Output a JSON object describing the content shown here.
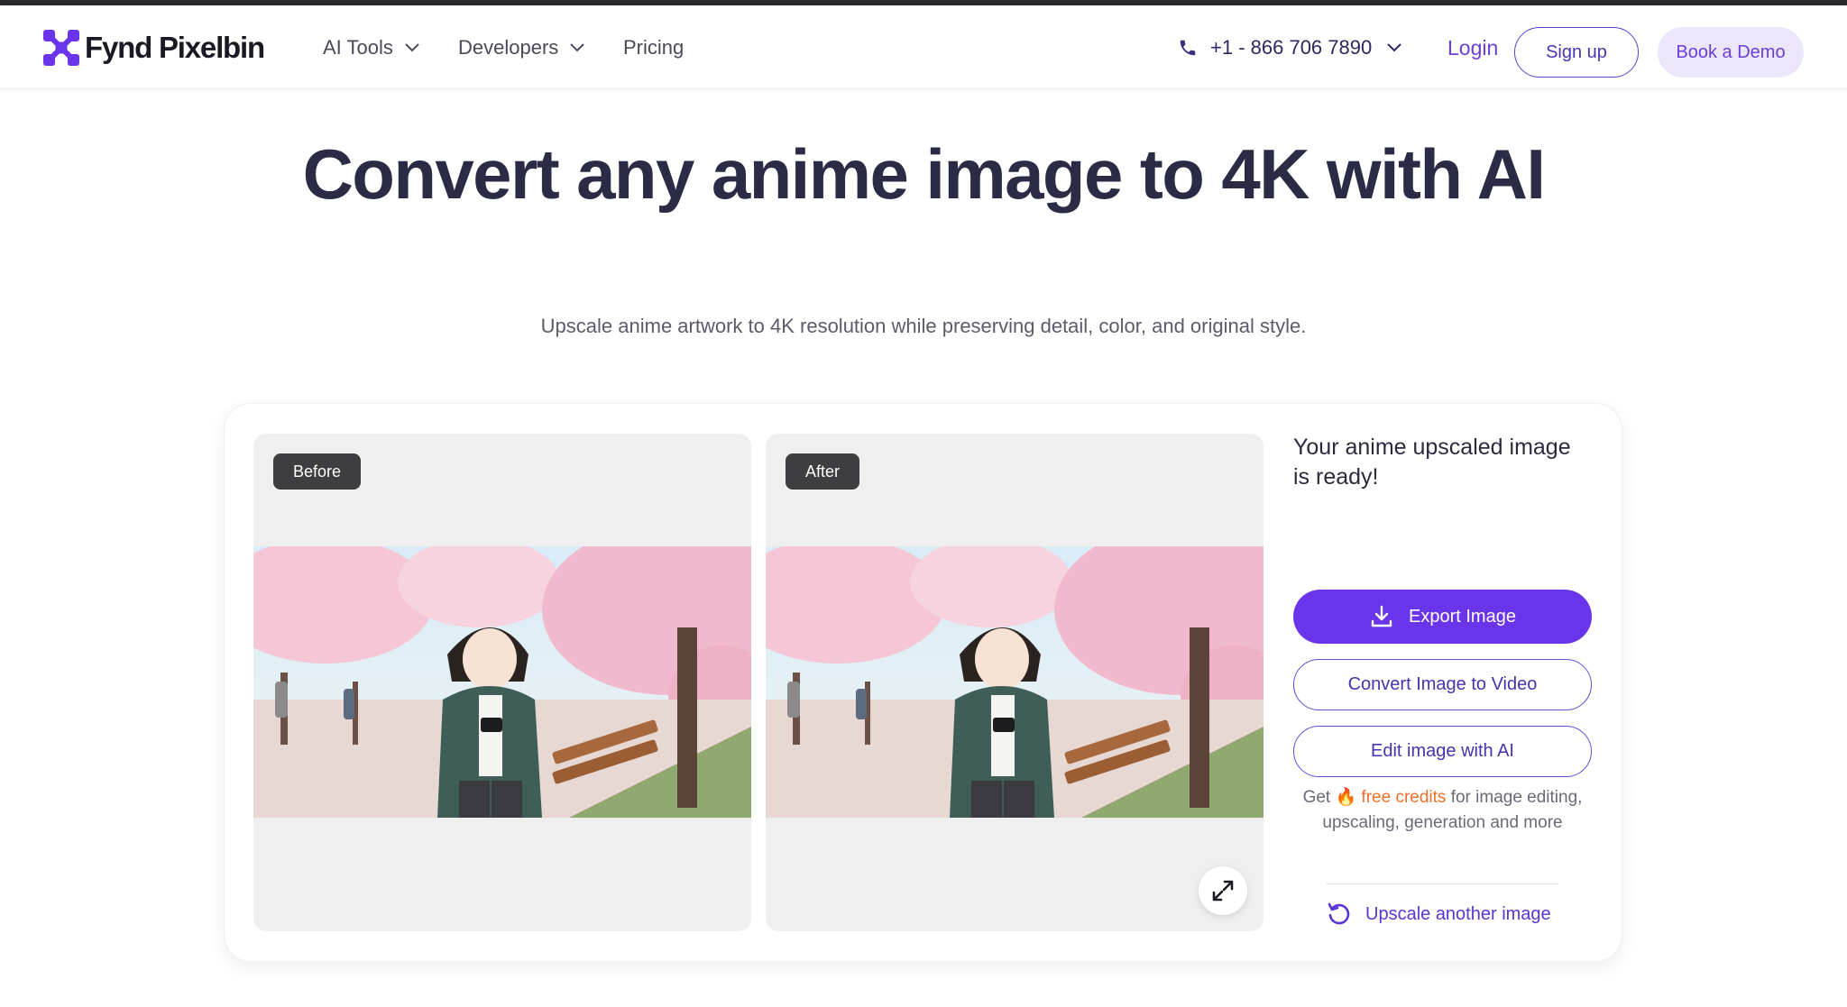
{
  "brand": {
    "name": "Fynd Pixelbin",
    "logo_color": "#6a35ea"
  },
  "nav": {
    "items": [
      {
        "label": "AI Tools",
        "has_dropdown": true
      },
      {
        "label": "Developers",
        "has_dropdown": true
      },
      {
        "label": "Pricing",
        "has_dropdown": false
      }
    ],
    "phone": "+1 - 866 706 7890",
    "login": "Login",
    "signup": "Sign up",
    "demo": "Book a Demo"
  },
  "hero": {
    "title": "Convert any anime image to 4K with AI",
    "subtitle": "Upscale anime artwork to 4K resolution while preserving detail, color, and original style."
  },
  "compare": {
    "before_label": "Before",
    "after_label": "After",
    "expand_icon": "expand-icon"
  },
  "result": {
    "ready_text": "Your anime upscaled image is ready!",
    "export_label": "Export Image",
    "video_label": "Convert Image to Video",
    "edit_label": "Edit image with AI",
    "credits_prefix": "Get",
    "credits_fire": "🔥",
    "credits_link": "free credits",
    "credits_suffix": "for image editing, upscaling, generation and more",
    "again_label": "Upscale another image"
  },
  "colors": {
    "accent": "#6a35ea",
    "credits_accent": "#f0702b",
    "title": "#2c2b45"
  }
}
